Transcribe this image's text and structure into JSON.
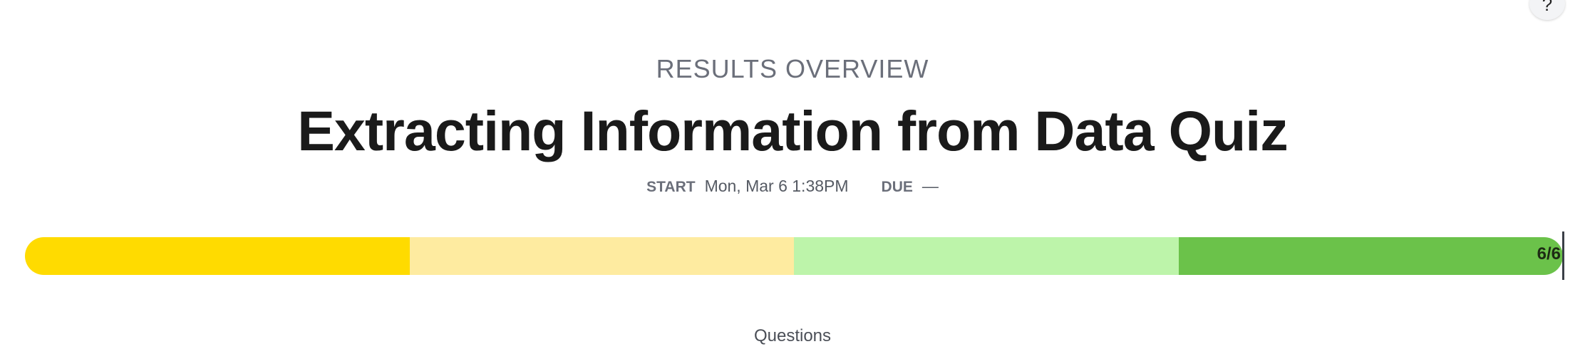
{
  "help": {
    "label": "?",
    "icon": "question-icon"
  },
  "header": {
    "eyebrow": "RESULTS OVERVIEW",
    "title": "Extracting Information from Data Quiz",
    "start_label": "START",
    "start_value": "Mon, Mar 6 1:38PM",
    "due_label": "DUE",
    "due_value": "—"
  },
  "progress": {
    "completed": 6,
    "total": 6,
    "count_text": "6/6",
    "segment_colors": [
      "#ffdb00",
      "#feeba0",
      "#bdf4aa",
      "#6bc24a"
    ]
  },
  "sections": {
    "questions_label": "Questions"
  }
}
